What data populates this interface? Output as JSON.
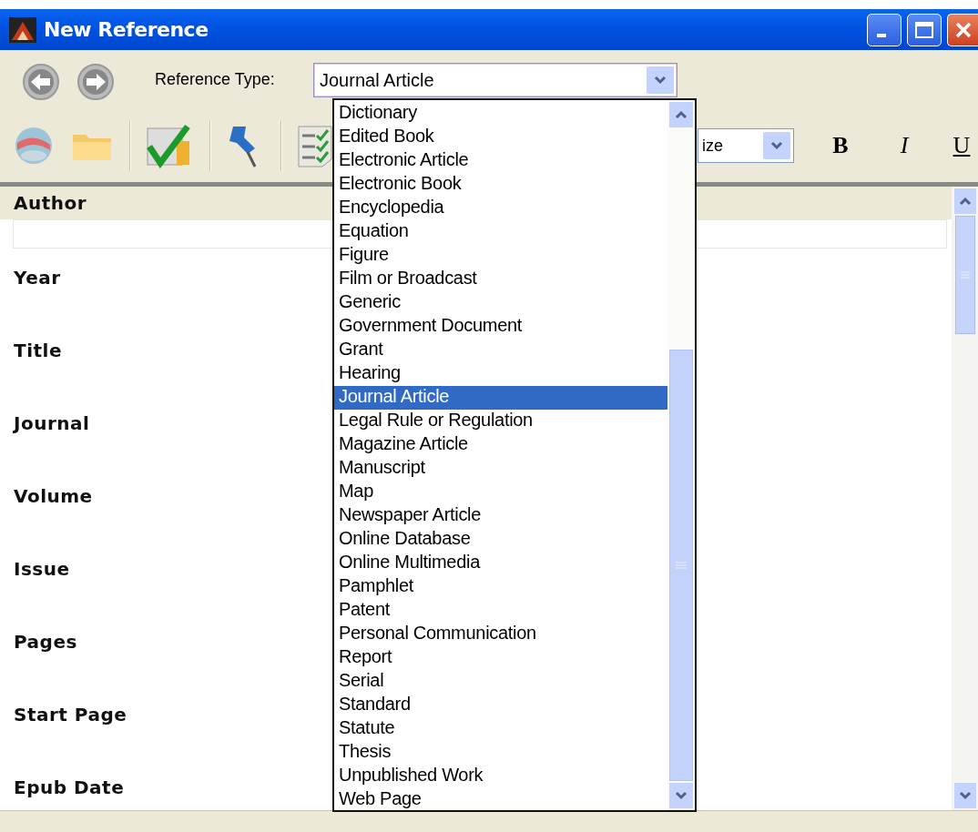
{
  "window": {
    "title": "New Reference"
  },
  "toolbar": {
    "reference_type_label": "Reference Type:",
    "reference_type": {
      "value": "Journal Article",
      "expanded": true
    },
    "font_size": {
      "value": "ize"
    },
    "format_buttons": [
      {
        "label": "B",
        "kind": "bold"
      },
      {
        "label": "I",
        "kind": "italic"
      },
      {
        "label": "U",
        "kind": "underline"
      }
    ]
  },
  "fields": [
    {
      "label": "Author",
      "kind": "band"
    },
    {
      "label": "Year",
      "kind": "plain"
    },
    {
      "label": "Title",
      "kind": "plain"
    },
    {
      "label": "Journal",
      "kind": "plain"
    },
    {
      "label": "Volume",
      "kind": "plain"
    },
    {
      "label": "Issue",
      "kind": "plain"
    },
    {
      "label": "Pages",
      "kind": "plain"
    },
    {
      "label": "Start Page",
      "kind": "plain"
    },
    {
      "label": "Epub Date",
      "kind": "plain"
    }
  ],
  "dropdown": {
    "items": [
      {
        "label": "Dictionary",
        "selected": false
      },
      {
        "label": "Edited Book",
        "selected": false
      },
      {
        "label": "Electronic Article",
        "selected": false
      },
      {
        "label": "Electronic Book",
        "selected": false
      },
      {
        "label": "Encyclopedia",
        "selected": false
      },
      {
        "label": "Equation",
        "selected": false
      },
      {
        "label": "Figure",
        "selected": false
      },
      {
        "label": "Film or Broadcast",
        "selected": false
      },
      {
        "label": "Generic",
        "selected": false
      },
      {
        "label": "Government Document",
        "selected": false
      },
      {
        "label": "Grant",
        "selected": false
      },
      {
        "label": "Hearing",
        "selected": false
      },
      {
        "label": "Journal Article",
        "selected": true
      },
      {
        "label": "Legal Rule or Regulation",
        "selected": false
      },
      {
        "label": "Magazine Article",
        "selected": false
      },
      {
        "label": "Manuscript",
        "selected": false
      },
      {
        "label": "Map",
        "selected": false
      },
      {
        "label": "Newspaper Article",
        "selected": false
      },
      {
        "label": "Online Database",
        "selected": false
      },
      {
        "label": "Online Multimedia",
        "selected": false
      },
      {
        "label": "Pamphlet",
        "selected": false
      },
      {
        "label": "Patent",
        "selected": false
      },
      {
        "label": "Personal Communication",
        "selected": false
      },
      {
        "label": "Report",
        "selected": false
      },
      {
        "label": "Serial",
        "selected": false
      },
      {
        "label": "Standard",
        "selected": false
      },
      {
        "label": "Statute",
        "selected": false
      },
      {
        "label": "Thesis",
        "selected": false
      },
      {
        "label": "Unpublished Work",
        "selected": false
      },
      {
        "label": "Web Page",
        "selected": false
      }
    ]
  }
}
